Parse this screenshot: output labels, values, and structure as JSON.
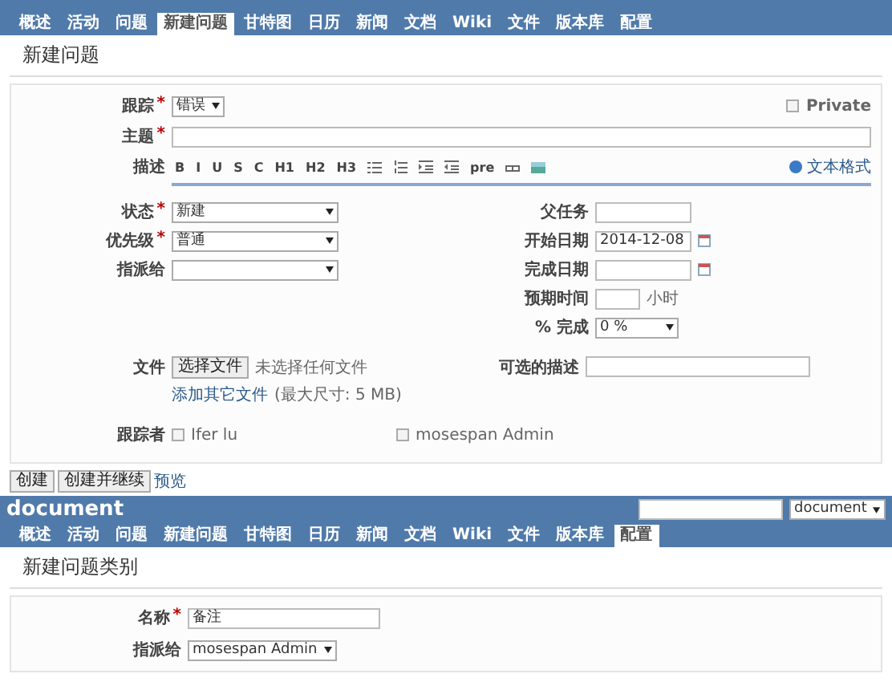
{
  "issue_screen": {
    "tabs": [
      {
        "label": "概述",
        "selected": false
      },
      {
        "label": "活动",
        "selected": false
      },
      {
        "label": "问题",
        "selected": false
      },
      {
        "label": "新建问题",
        "selected": true
      },
      {
        "label": "甘特图",
        "selected": false
      },
      {
        "label": "日历",
        "selected": false
      },
      {
        "label": "新闻",
        "selected": false
      },
      {
        "label": "文档",
        "selected": false
      },
      {
        "label": "Wiki",
        "selected": false
      },
      {
        "label": "文件",
        "selected": false
      },
      {
        "label": "版本库",
        "selected": false
      },
      {
        "label": "配置",
        "selected": false
      }
    ],
    "title": "新建问题",
    "tracker": {
      "label": "跟踪",
      "required_mark": "*",
      "value": "错误"
    },
    "private": {
      "label": "Private",
      "checked": false
    },
    "subject": {
      "label": "主题",
      "required_mark": "*"
    },
    "description": {
      "label": "描述",
      "toolbar": [
        {
          "kind": "text",
          "label": "B"
        },
        {
          "kind": "text",
          "label": "I"
        },
        {
          "kind": "text",
          "label": "U"
        },
        {
          "kind": "text",
          "label": "S"
        },
        {
          "kind": "text",
          "label": "C"
        },
        {
          "kind": "text",
          "label": "H1"
        },
        {
          "kind": "text",
          "label": "H2"
        },
        {
          "kind": "text",
          "label": "H3"
        },
        {
          "kind": "bullets"
        },
        {
          "kind": "numbers"
        },
        {
          "kind": "indent"
        },
        {
          "kind": "outdent"
        },
        {
          "kind": "text",
          "label": "pre"
        },
        {
          "kind": "link"
        },
        {
          "kind": "image"
        }
      ],
      "help_link": "文本格式"
    },
    "left_fields": [
      {
        "label": "状态",
        "required_mark": "*",
        "value": "新建"
      },
      {
        "label": "优先级",
        "required_mark": "*",
        "value": "普通"
      },
      {
        "label": "指派给"
      }
    ],
    "right_fields": [
      {
        "kind": "text",
        "label": "父任务"
      },
      {
        "kind": "date",
        "label": "开始日期",
        "value": "2014-12-08"
      },
      {
        "kind": "date",
        "label": "完成日期"
      },
      {
        "kind": "hours",
        "label": "预期时间",
        "unit": "小时"
      },
      {
        "kind": "select",
        "label": "% 完成",
        "value": "0 %"
      }
    ],
    "files": {
      "label": "文件",
      "button": "选择文件",
      "status": "未选择任何文件",
      "add_link": "添加其它文件",
      "max_size": "(最大尺寸: 5 MB)",
      "description_label": "可选的描述"
    },
    "watchers": {
      "label": "跟踪者",
      "people": [
        {
          "name": "Ifer lu",
          "checked": false
        },
        {
          "name": "mosespan Admin",
          "checked": false
        }
      ]
    },
    "buttons": [
      "创建",
      "创建并继续"
    ],
    "preview_link": "预览"
  },
  "category_screen": {
    "project": "document",
    "project_select": "document",
    "tabs": [
      {
        "label": "概述",
        "selected": false
      },
      {
        "label": "活动",
        "selected": false
      },
      {
        "label": "问题",
        "selected": false
      },
      {
        "label": "新建问题",
        "selected": false
      },
      {
        "label": "甘特图",
        "selected": false
      },
      {
        "label": "日历",
        "selected": false
      },
      {
        "label": "新闻",
        "selected": false
      },
      {
        "label": "文档",
        "selected": false
      },
      {
        "label": "Wiki",
        "selected": false
      },
      {
        "label": "文件",
        "selected": false
      },
      {
        "label": "版本库",
        "selected": false
      },
      {
        "label": "配置",
        "selected": true
      }
    ],
    "title": "新建问题类别",
    "name": {
      "label": "名称",
      "required_mark": "*",
      "value": "备注"
    },
    "assignee": {
      "label": "指派给",
      "value": "mosespan Admin"
    }
  }
}
